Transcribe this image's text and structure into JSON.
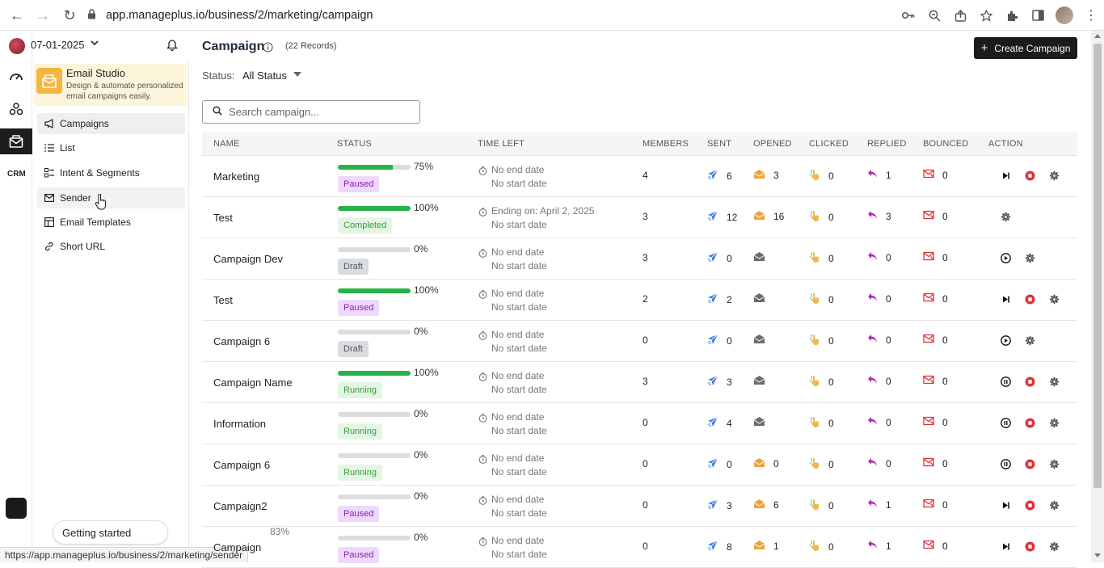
{
  "browser": {
    "url": "app.manageplus.io/business/2/marketing/campaign",
    "status_url": "https://app.manageplus.io/business/2/marketing/sender"
  },
  "header": {
    "date": "07-01-2025"
  },
  "studio": {
    "title": "Email Studio",
    "description": "Design & automate personalized email campaigns easily."
  },
  "sidebar": {
    "items": [
      {
        "label": "Campaigns",
        "icon": "megaphone-icon"
      },
      {
        "label": "List",
        "icon": "list-icon"
      },
      {
        "label": "Intent & Segments",
        "icon": "segments-icon"
      },
      {
        "label": "Sender",
        "icon": "mail-icon"
      },
      {
        "label": "Email Templates",
        "icon": "template-icon"
      },
      {
        "label": "Short URL",
        "icon": "link-icon"
      }
    ]
  },
  "getting_started": {
    "label": "Getting started",
    "percent": "83%"
  },
  "page": {
    "title": "Campaign",
    "records": "(22 Records)",
    "create_label": "Create Campaign",
    "status_label": "Status:",
    "status_value": "All Status",
    "search_placeholder": "Search campaign..."
  },
  "columns": [
    "NAME",
    "STATUS",
    "TIME LEFT",
    "MEMBERS",
    "SENT",
    "OPENED",
    "CLICKED",
    "REPLIED",
    "BOUNCED",
    "ACTION"
  ],
  "colors": {
    "progress": "#27b24a",
    "paused": "#8a21b8",
    "running": "#3a9a3a",
    "bounced": "#e0323c",
    "replied": "#b02ab0",
    "sent": "#3b7dd8",
    "opened": "#f0a33b",
    "stop": "#e0323c"
  },
  "rows": [
    {
      "name": "Marketing",
      "progress": 75,
      "pct": "75%",
      "status": "Paused",
      "t1": "No end date",
      "t2": "No start date",
      "members": "4",
      "sent": "6",
      "opened": "3",
      "opened_active": true,
      "clicked": "0",
      "replied": "1",
      "bounced": "0",
      "actions": [
        "resume",
        "stop",
        "settings"
      ]
    },
    {
      "name": "Test",
      "progress": 100,
      "pct": "100%",
      "status": "Completed",
      "t1": "Ending on: April 2, 2025",
      "t2": "No start date",
      "members": "3",
      "sent": "12",
      "opened": "16",
      "opened_active": true,
      "clicked": "0",
      "replied": "3",
      "bounced": "0",
      "actions": [
        "settings"
      ]
    },
    {
      "name": "Campaign Dev",
      "progress": 0,
      "pct": "0%",
      "status": "Draft",
      "t1": "No end date",
      "t2": "No start date",
      "members": "3",
      "sent": "0",
      "opened": "",
      "opened_active": false,
      "clicked": "0",
      "replied": "0",
      "bounced": "0",
      "actions": [
        "play",
        "settings"
      ]
    },
    {
      "name": "Test",
      "progress": 100,
      "pct": "100%",
      "status": "Paused",
      "t1": "No end date",
      "t2": "No start date",
      "members": "2",
      "sent": "2",
      "opened": "",
      "opened_active": false,
      "clicked": "0",
      "replied": "0",
      "bounced": "0",
      "actions": [
        "resume",
        "stop",
        "settings"
      ]
    },
    {
      "name": "Campaign 6",
      "progress": 0,
      "pct": "0%",
      "status": "Draft",
      "t1": "No end date",
      "t2": "No start date",
      "members": "0",
      "sent": "0",
      "opened": "",
      "opened_active": false,
      "clicked": "0",
      "replied": "0",
      "bounced": "0",
      "actions": [
        "play",
        "settings"
      ]
    },
    {
      "name": "Campaign Name",
      "progress": 100,
      "pct": "100%",
      "status": "Running",
      "t1": "No end date",
      "t2": "No start date",
      "members": "3",
      "sent": "3",
      "opened": "",
      "opened_active": false,
      "clicked": "0",
      "replied": "0",
      "bounced": "0",
      "actions": [
        "pause",
        "stop",
        "settings"
      ]
    },
    {
      "name": "Information",
      "progress": 0,
      "pct": "0%",
      "status": "Running",
      "t1": "No end date",
      "t2": "No start date",
      "members": "0",
      "sent": "4",
      "opened": "",
      "opened_active": false,
      "clicked": "0",
      "replied": "0",
      "bounced": "0",
      "actions": [
        "pause",
        "stop",
        "settings"
      ]
    },
    {
      "name": "Campaign 6",
      "progress": 0,
      "pct": "0%",
      "status": "Running",
      "t1": "No end date",
      "t2": "No start date",
      "members": "0",
      "sent": "0",
      "opened": "0",
      "opened_active": true,
      "clicked": "0",
      "replied": "0",
      "bounced": "0",
      "actions": [
        "pause",
        "stop",
        "settings"
      ]
    },
    {
      "name": "Campaign2",
      "progress": 0,
      "pct": "0%",
      "status": "Paused",
      "t1": "No end date",
      "t2": "No start date",
      "members": "0",
      "sent": "3",
      "opened": "6",
      "opened_active": true,
      "clicked": "0",
      "replied": "1",
      "bounced": "0",
      "actions": [
        "resume",
        "stop",
        "settings"
      ]
    },
    {
      "name": "Campaign",
      "progress": 0,
      "pct": "0%",
      "status": "Paused",
      "t1": "No end date",
      "t2": "No start date",
      "members": "0",
      "sent": "8",
      "opened": "1",
      "opened_active": true,
      "clicked": "0",
      "replied": "1",
      "bounced": "0",
      "actions": [
        "resume",
        "stop",
        "settings"
      ]
    }
  ]
}
